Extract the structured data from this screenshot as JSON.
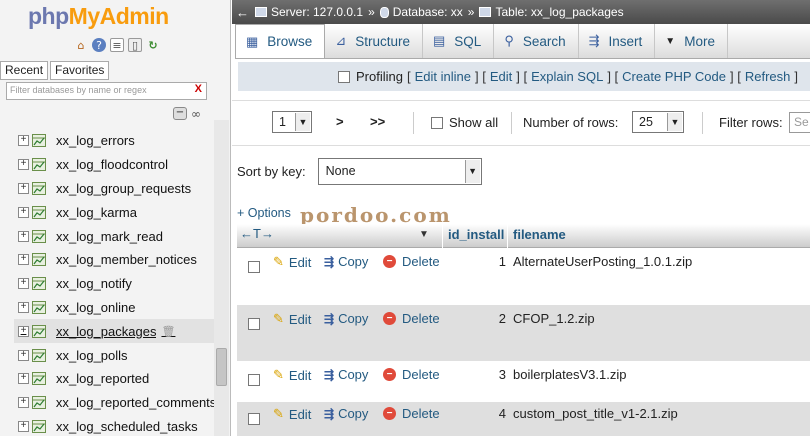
{
  "app": {
    "logo_php": "php",
    "logo_my": "My",
    "logo_admin": "Admin"
  },
  "nav": {
    "recent_tab": "Recent",
    "favorites_tab": "Favorites",
    "filter_placeholder": "Filter databases by name or regex",
    "filter_clear": "X",
    "tables": [
      "xx_log_errors",
      "xx_log_floodcontrol",
      "xx_log_group_requests",
      "xx_log_karma",
      "xx_log_mark_read",
      "xx_log_member_notices",
      "xx_log_notify",
      "xx_log_online",
      "xx_log_packages",
      "xx_log_polls",
      "xx_log_reported",
      "xx_log_reported_comments",
      "xx_log_scheduled_tasks"
    ],
    "active_table": "xx_log_packages"
  },
  "breadcrumb": {
    "server": "Server: 127.0.0.1",
    "database": "Database: xx",
    "table": "Table: xx_log_packages"
  },
  "tabs": {
    "browse": "Browse",
    "structure": "Structure",
    "sql": "SQL",
    "search": "Search",
    "insert": "Insert",
    "more": "More"
  },
  "profiling": {
    "label": "Profiling",
    "edit_inline": "Edit inline",
    "edit": "Edit",
    "explain_sql": "Explain SQL",
    "create_php": "Create PHP Code",
    "refresh": "Refresh"
  },
  "pager": {
    "page": "1",
    "next": ">",
    "last": ">>",
    "show_all": "Show all",
    "number_of_rows_label": "Number of rows:",
    "number_of_rows": "25",
    "filter_rows_label": "Filter rows:",
    "filter_rows_placeholder": "Se"
  },
  "sort": {
    "label": "Sort by key:",
    "value": "None"
  },
  "options_link": "+ Options",
  "watermark": "pordoo.com",
  "table": {
    "col_id": "id_install",
    "col_filename": "filename",
    "arrows": "←T→",
    "edit_label": "Edit",
    "copy_label": "Copy",
    "delete_label": "Delete",
    "rows": [
      {
        "id": "1",
        "filename": "AlternateUserPosting_1.0.1.zip"
      },
      {
        "id": "2",
        "filename": "CFOP_1.2.zip"
      },
      {
        "id": "3",
        "filename": "boilerplatesV3.1.zip"
      },
      {
        "id": "4",
        "filename": "custom_post_title_v1-2.1.zip"
      }
    ]
  },
  "colors": {
    "link": "#235a81",
    "row_alt": "#dfdfdf",
    "topbar": "#5a5a5a"
  }
}
